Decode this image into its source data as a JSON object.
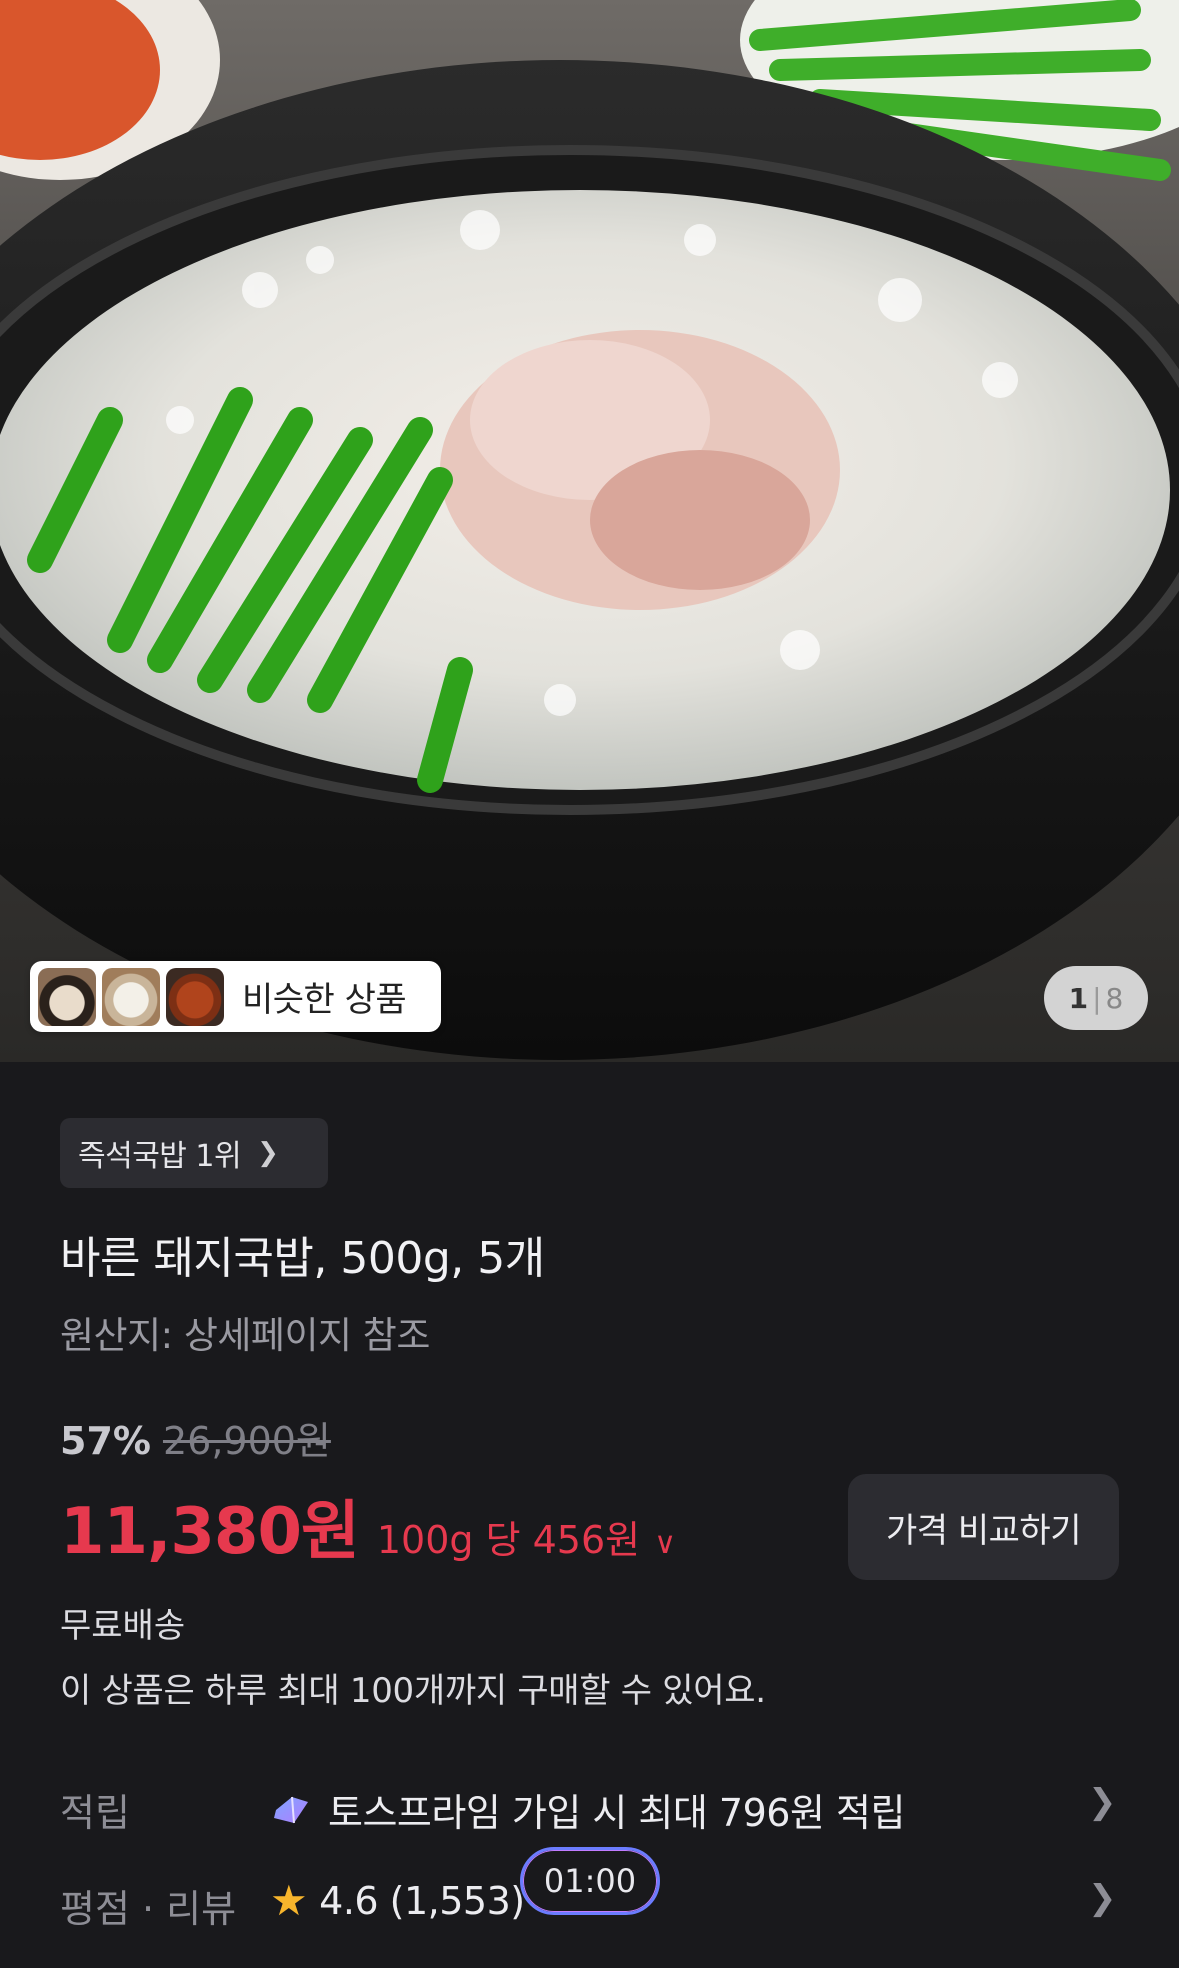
{
  "gallery": {
    "similar_label": "비슷한 상품",
    "counter_current": "1",
    "counter_separator": "|",
    "counter_total": "8"
  },
  "product": {
    "rank_badge": "즉석국밥 1위",
    "title": "바른 돼지국밥, 500g, 5개",
    "origin": "원산지: 상세페이지 참조",
    "discount": "57%",
    "original_price": "26,900원",
    "price": "11,380원",
    "unit_price": "100g 당 456원",
    "compare_button": "가격 비교하기",
    "shipping": "무료배송",
    "purchase_limit": "이 상품은 하루 최대 100개까지 구매할 수 있어요."
  },
  "rows": {
    "points_label": "적립",
    "points_value": "토스프라임 가입 시 최대 796원 적립",
    "rating_label": "평점 · 리뷰",
    "rating_value": "4.6 (1,553)"
  },
  "overlay": {
    "timer": "01:00"
  },
  "colors": {
    "background": "#19191c",
    "accent_price": "#e6394e",
    "chip_bg": "#2c2c31",
    "star": "#f7b52c"
  }
}
